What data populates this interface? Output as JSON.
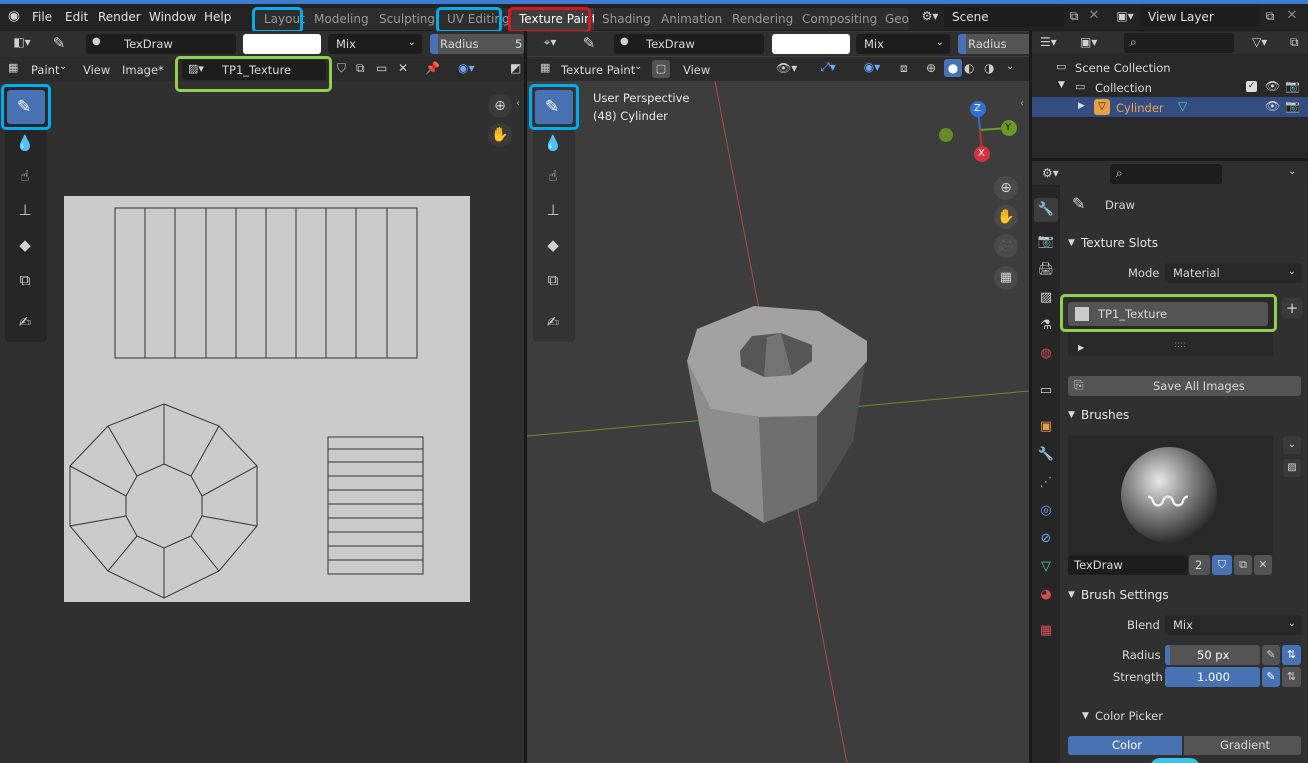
{
  "menubar": {
    "items": [
      "File",
      "Edit",
      "Render",
      "Window",
      "Help"
    ],
    "workspaces": [
      "Layout",
      "Modeling",
      "Sculpting",
      "UV Editing",
      "Texture Paint",
      "Shading",
      "Animation",
      "Rendering",
      "Compositing",
      "Geo"
    ],
    "scene": "Scene",
    "view_layer": "View Layer"
  },
  "image_editor": {
    "brush_name": "TexDraw",
    "blend": "Mix",
    "radius_label": "Radius",
    "radius_partial": "5",
    "mode": "Paint",
    "view_menu": "View",
    "image_menu": "Image*",
    "image_name": "TP1_Texture"
  },
  "viewport": {
    "brush_name": "TexDraw",
    "blend": "Mix",
    "radius_label": "Radius",
    "mode": "Texture Paint",
    "view_menu": "View",
    "overlay_title": "User Perspective",
    "overlay_object": "(48) Cylinder",
    "gizmo": {
      "z": "Z",
      "y": "Y",
      "x": "X"
    }
  },
  "outliner": {
    "scene_collection": "Scene Collection",
    "collection": "Collection",
    "object": "Cylinder"
  },
  "properties": {
    "tool_name": "Draw",
    "texture_slots": {
      "title": "Texture Slots",
      "mode_label": "Mode",
      "mode_value": "Material",
      "slot": "TP1_Texture",
      "save_all": "Save All Images"
    },
    "brushes": {
      "title": "Brushes",
      "brush_name": "TexDraw",
      "users": "2"
    },
    "brush_settings": {
      "title": "Brush Settings",
      "blend_label": "Blend",
      "blend_value": "Mix",
      "radius_label": "Radius",
      "radius_value": "50 px",
      "strength_label": "Strength",
      "strength_value": "1.000",
      "strength_fill": 1.0
    },
    "color_picker": {
      "title": "Color Picker",
      "tab_color": "Color",
      "tab_gradient": "Gradient"
    }
  },
  "colors": {
    "accent_blue": "#4772b3",
    "highlight_blue": "#00aeef",
    "highlight_red": "#e0141e",
    "highlight_green": "#8fd14f",
    "selected_object": "#f0a24a"
  }
}
